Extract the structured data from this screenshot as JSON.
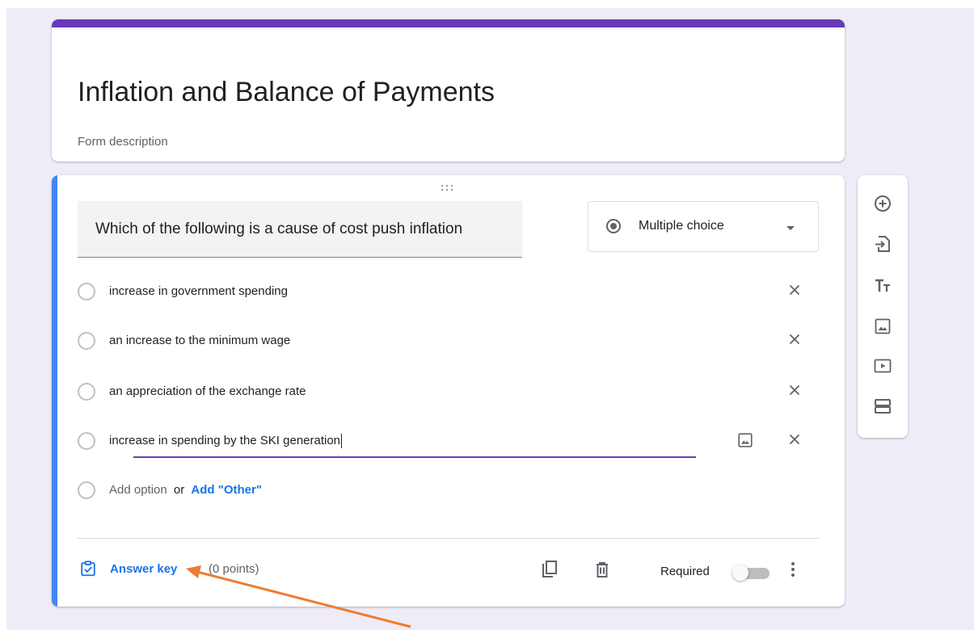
{
  "form": {
    "title": "Inflation and Balance of Payments",
    "description_placeholder": "Form description"
  },
  "question": {
    "text": "Which of the following is a cause of cost push inflation",
    "type": "Multiple choice",
    "options": [
      "increase in government spending",
      "an increase to the minimum wage",
      "an appreciation of the exchange rate",
      "increase in spending by the SKI generation"
    ],
    "add_option": "Add option",
    "or": "or",
    "add_other": "Add \"Other\""
  },
  "footer": {
    "answer_key": "Answer key",
    "points": "(0 points)",
    "required": "Required",
    "required_on": false
  },
  "sidebar_tools": [
    "add-question-icon",
    "import-questions-icon",
    "add-title-icon",
    "add-image-icon",
    "add-video-icon",
    "add-section-icon"
  ],
  "colors": {
    "accent": "#673ab7",
    "active_bar": "#4285f4",
    "link": "#1a73e8",
    "background": "#efecf8",
    "annotation_arrow": "#ed7d31"
  }
}
